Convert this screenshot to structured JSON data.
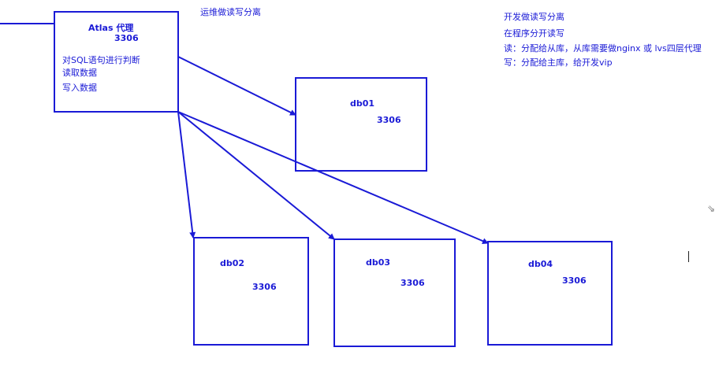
{
  "proxy": {
    "title": "Atlas 代理",
    "port": "3306",
    "line1": "对SQL语句进行判断",
    "line2": "读取数据",
    "line3": "写入数据"
  },
  "ops_note": "运维做读写分离",
  "dev_notes": {
    "line1": "开发做读写分离",
    "line2": "在程序分开读写",
    "line3": "读：分配给从库，从库需要做nginx 或 lvs四层代理",
    "line4": "写：分配给主库，给开发vip"
  },
  "dbs": [
    {
      "name": "db01",
      "port": "3306"
    },
    {
      "name": "db02",
      "port": "3306"
    },
    {
      "name": "db03",
      "port": "3306"
    },
    {
      "name": "db04",
      "port": "3306"
    }
  ],
  "colors": {
    "line": "#1a1ad6",
    "text": "#1a1ad6"
  }
}
